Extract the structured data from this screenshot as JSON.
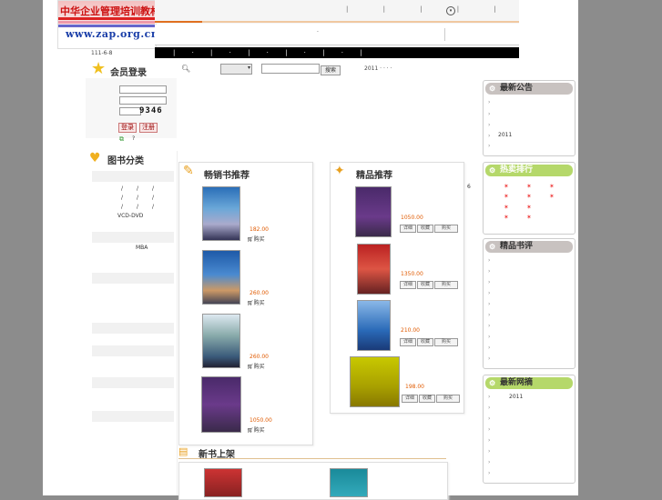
{
  "header": {
    "logo_title": "中华企业管理培训教材网",
    "logo_url": "www.zap.org.cn",
    "date": "111-6-8",
    "topnav_marks": "|   |   |   |   |",
    "black_bar": "| · | · | · | · | · |"
  },
  "search": {
    "button": "搜索",
    "info": "2011 ·  ·     ·  ·"
  },
  "login": {
    "title": "会员登录",
    "captcha": "9346",
    "login_button": "登录",
    "register_button": "注册",
    "help": "?"
  },
  "categories": {
    "title": "图书分类",
    "items": [
      "VCD-DVD",
      "MBA"
    ]
  },
  "bestsellers": {
    "title": "畅销书推荐",
    "items": [
      {
        "price": "182.00",
        "buy": "购买"
      },
      {
        "price": "260.00",
        "buy": "购买"
      },
      {
        "price": "260.00",
        "buy": "购买"
      },
      {
        "price": "1050.00",
        "buy": "购买"
      }
    ]
  },
  "featured": {
    "title": "精品推荐",
    "items": [
      {
        "price": "1050.00",
        "detail": "详细",
        "fav": "收藏",
        "buy": "购买"
      },
      {
        "price": "1350.00",
        "detail": "详细",
        "fav": "收藏",
        "buy": "购买"
      },
      {
        "price": "210.00",
        "detail": "详细",
        "fav": "收藏",
        "buy": "购买"
      },
      {
        "price": "198.00",
        "detail": "详细",
        "fav": "收藏",
        "buy": "购买"
      }
    ]
  },
  "new_books": {
    "title": "新书上架"
  },
  "right": {
    "notice": {
      "title": "最新公告",
      "line": "2011"
    },
    "hot": {
      "title": "热卖排行"
    },
    "reviews": {
      "title": "精品书评"
    },
    "latest": {
      "title": "最新网摘",
      "line": "2011"
    }
  },
  "colors": {
    "accent": "#e05a00",
    "panel_green": "#b5d86a",
    "panel_gray": "#c8c2c0"
  }
}
